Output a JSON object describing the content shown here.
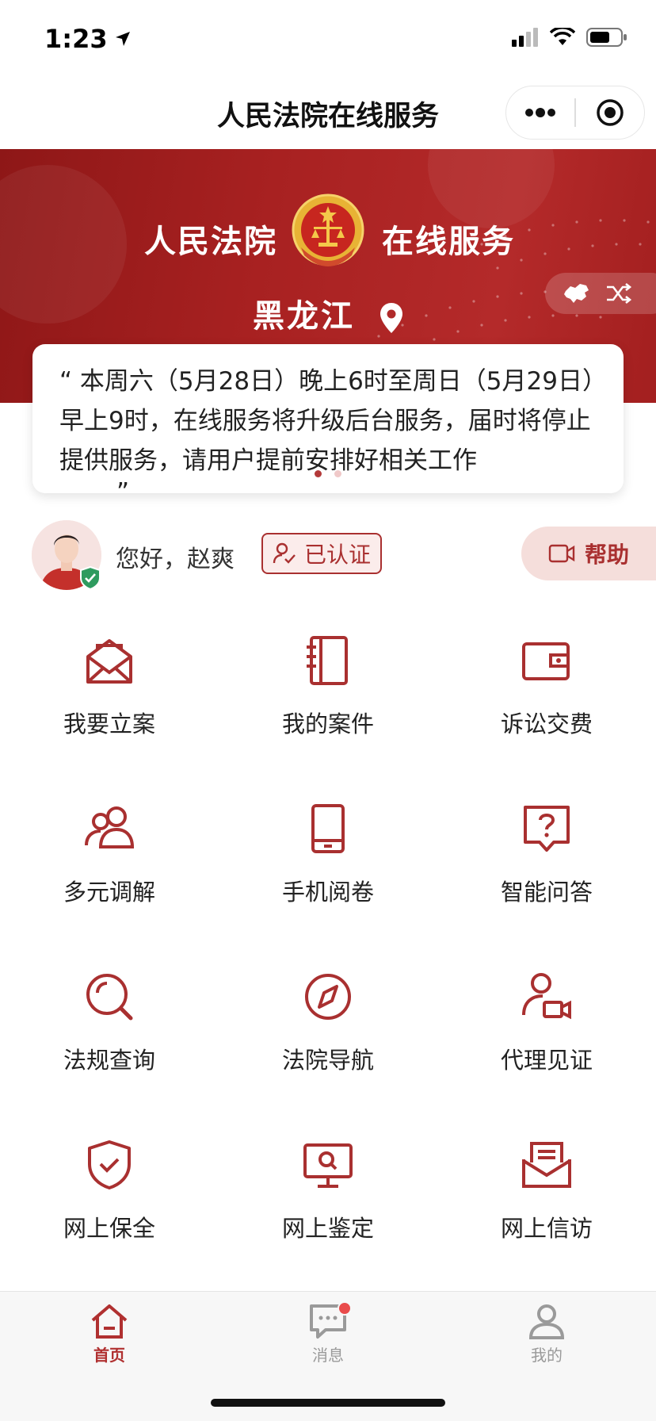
{
  "status_bar": {
    "time": "1:23"
  },
  "nav": {
    "title": "人民法院在线服务"
  },
  "hero": {
    "title_left": "人民法院",
    "title_right": "在线服务",
    "region": "黑龙江"
  },
  "notice": {
    "text": "“ 本周六（5月28日）晚上6时至周日（5月29日）早上9时，在线服务将升级后台服务，届时将停止提供服务，请用户提前安排好相关工作",
    "closing_quote": "”"
  },
  "user": {
    "greeting": "您好，赵爽",
    "cert_label": "已认证",
    "help_label": "帮助"
  },
  "services": [
    {
      "label": "我要立案",
      "icon": "envelope-open-icon"
    },
    {
      "label": "我的案件",
      "icon": "notebook-icon"
    },
    {
      "label": "诉讼交费",
      "icon": "wallet-icon"
    },
    {
      "label": "多元调解",
      "icon": "users-icon"
    },
    {
      "label": "手机阅卷",
      "icon": "tablet-icon"
    },
    {
      "label": "智能问答",
      "icon": "question-bubble-icon"
    },
    {
      "label": "法规查询",
      "icon": "search-icon"
    },
    {
      "label": "法院导航",
      "icon": "compass-icon"
    },
    {
      "label": "代理见证",
      "icon": "user-video-icon"
    },
    {
      "label": "网上保全",
      "icon": "shield-check-icon"
    },
    {
      "label": "网上鉴定",
      "icon": "monitor-search-icon"
    },
    {
      "label": "网上信访",
      "icon": "mail-letter-icon"
    }
  ],
  "tabs": [
    {
      "label": "首页",
      "icon": "home-icon",
      "active": true
    },
    {
      "label": "消息",
      "icon": "message-icon",
      "active": false,
      "badge": true
    },
    {
      "label": "我的",
      "icon": "user-icon",
      "active": false
    }
  ],
  "colors": {
    "brand": "#a93030",
    "hero": "#a82121",
    "badge": "#e94b4b"
  }
}
